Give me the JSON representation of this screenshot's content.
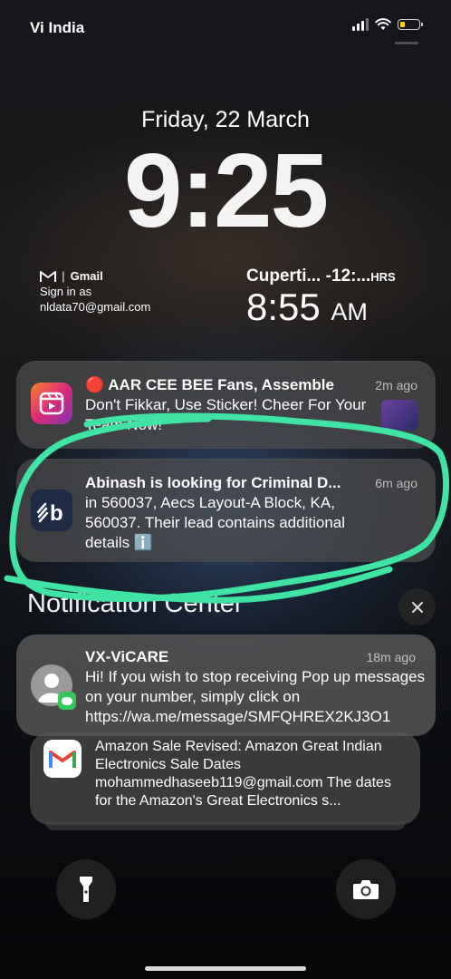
{
  "status_bar": {
    "carrier": "Vi India",
    "battery_level": 0.2
  },
  "lock_screen": {
    "date": "Friday, 22 March",
    "time": "9:25"
  },
  "widgets": {
    "gmail": {
      "title": "Gmail",
      "line1": "Sign in as",
      "email": "nldata70@gmail.com"
    },
    "world_clock": {
      "city": "Cuperti... -12:...",
      "suffix": "HRS",
      "time": "8:55",
      "period": "AM"
    }
  },
  "notifications": [
    {
      "app": "Instagram",
      "title": "🔴 AAR CEE BEE Fans, Assemble",
      "body": "Don't Fikkar, Use Sticker! Cheer For Your Team Now!",
      "time": "2m ago"
    },
    {
      "app": "b",
      "title": "Abinash is looking for Criminal D...",
      "body": "in 560037, Aecs Layout-A Block, KA, 560037. Their lead contains additional details ℹ️",
      "time": "6m ago"
    }
  ],
  "notification_center": {
    "label": "Notification Center",
    "items": [
      {
        "app": "Messages",
        "title": "VX-ViCARE",
        "body": "Hi! If you wish to stop receiving Pop up messages on your number, simply click on https://wa.me/message/SMFQHREX2KJ3O1",
        "time": "18m ago"
      },
      {
        "app": "Gmail",
        "title": "Amazon Sale Revised: Amazon Great Indian Electronics Sale Dates",
        "body": "mohammedhaseeb119@gmail.com The dates for the Amazon's Great Electronics s..."
      }
    ]
  },
  "colors": {
    "highlight_stroke": "#3fe3a3",
    "battery_fill": "#f5d000",
    "instagram": "#e1306c"
  }
}
